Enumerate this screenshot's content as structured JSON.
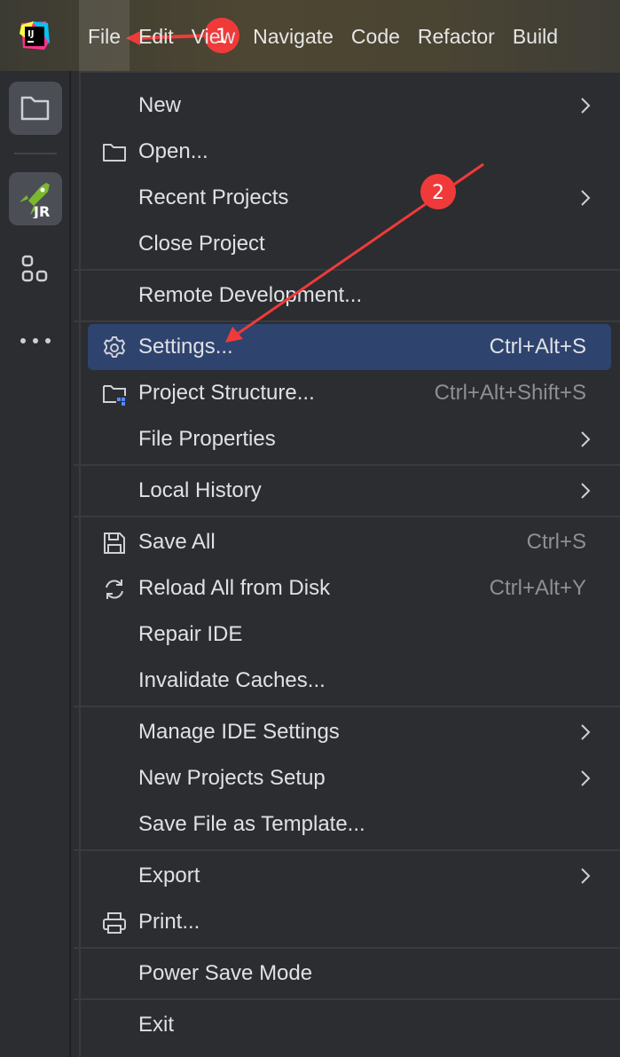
{
  "menubar": {
    "items": [
      {
        "label": "File",
        "mn": 0,
        "active": true
      },
      {
        "label": "Edit",
        "mn": 0
      },
      {
        "label": "View",
        "mn": 0
      },
      {
        "label": "Navigate",
        "mn": 0
      },
      {
        "label": "Code",
        "mn": 0
      },
      {
        "label": "Refactor",
        "mn": 0
      },
      {
        "label": "Build",
        "mn": 0
      }
    ]
  },
  "sidebar": {
    "icons": [
      "project-folder-icon",
      "jrebel-icon",
      "plugins-icon",
      "more-icon"
    ],
    "jrebel_badge": "JR"
  },
  "logo": "IJ",
  "file_menu": {
    "groups": [
      [
        {
          "label": "New",
          "mn": 0,
          "submenu": true
        },
        {
          "label": "Open...",
          "mn": 0,
          "icon": "folder-icon"
        },
        {
          "label": "Recent Projects",
          "mn": 0,
          "submenu": true
        },
        {
          "label": "Close Project",
          "mn": 7
        }
      ],
      [
        {
          "label": "Remote Development...",
          "mn": -1
        }
      ],
      [
        {
          "label": "Settings...",
          "mn": 2,
          "icon": "gear-icon",
          "shortcut": "Ctrl+Alt+S",
          "highlighted": true
        },
        {
          "label": "Project Structure...",
          "mn": -1,
          "icon": "project-structure-icon",
          "shortcut": "Ctrl+Alt+Shift+S"
        },
        {
          "label": "File Properties",
          "mn": -1,
          "submenu": true
        }
      ],
      [
        {
          "label": "Local History",
          "mn": 6,
          "submenu": true
        }
      ],
      [
        {
          "label": "Save All",
          "mn": 0,
          "icon": "save-icon",
          "shortcut": "Ctrl+S"
        },
        {
          "label": "Reload All from Disk",
          "mn": -1,
          "icon": "reload-icon",
          "shortcut": "Ctrl+Alt+Y"
        },
        {
          "label": "Repair IDE",
          "mn": -1
        },
        {
          "label": "Invalidate Caches...",
          "mn": -1
        }
      ],
      [
        {
          "label": "Manage IDE Settings",
          "mn": -1,
          "submenu": true
        },
        {
          "label": "New Projects Setup",
          "mn": -1,
          "submenu": true
        },
        {
          "label": "Save File as Template...",
          "mn": 18
        }
      ],
      [
        {
          "label": "Export",
          "mn": -1,
          "submenu": true
        },
        {
          "label": "Print...",
          "mn": 0,
          "icon": "print-icon"
        }
      ],
      [
        {
          "label": "Power Save Mode",
          "mn": -1
        }
      ],
      [
        {
          "label": "Exit",
          "mn": 1
        }
      ]
    ]
  },
  "annotations": [
    {
      "number": "1"
    },
    {
      "number": "2"
    }
  ],
  "colors": {
    "highlight": "#2e436e",
    "annotation": "#f03a3a"
  }
}
